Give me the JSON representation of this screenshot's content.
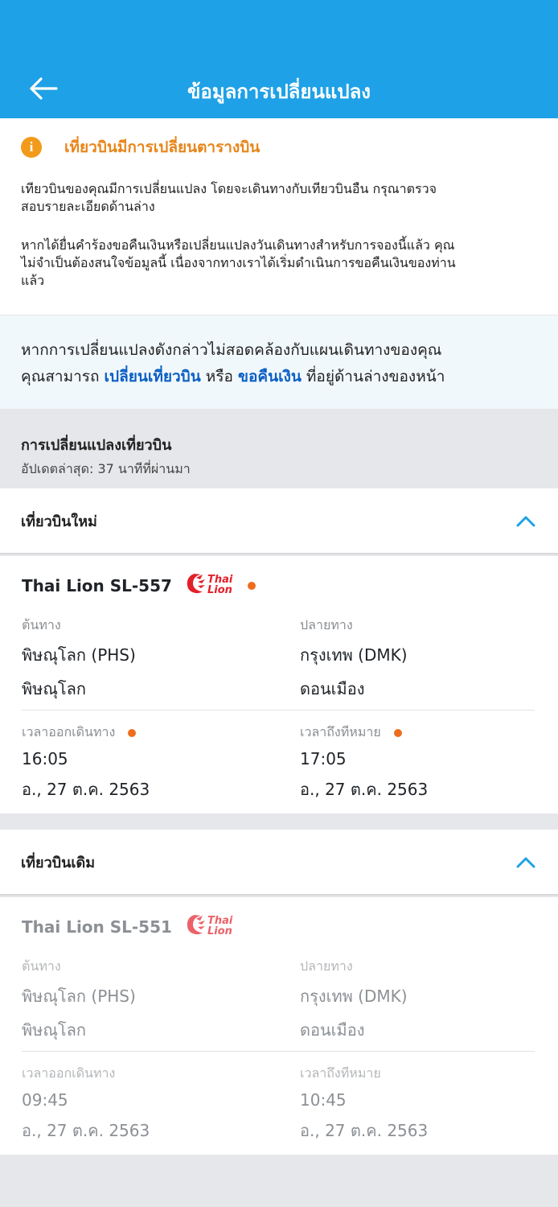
{
  "header": {
    "title": "ข้อมูลการเปลี่ยนแปลง",
    "back_icon": "arrow-left-icon"
  },
  "notice": {
    "title": "เที่ยวบินมีการเปลี่ยนตารางบิน",
    "icon": "info-icon",
    "icon_glyph": "i",
    "paragraph1_line1": "เทียวบินของคุณมีการเปลี่ยนแปลง โดยจะเดินทางกับเทียวบินอืน กรุณาตรวจ",
    "paragraph1_line2": "สอบรายละเอียดด้านล่าง",
    "paragraph2_line1": "หากได้ยื่นคำร้องขอคืนเงินหรือเปลี่ยนแปลงวันเดินทางสำหรับการจองนี้แล้ว คุณ",
    "paragraph2_line2": "ไม่จำเป็นต้องสนใจข้อมูลนี้ เนื่องจากทางเราได้เริ่มดำเนินการขอคืนเงินของท่าน",
    "paragraph2_line3": "แล้ว"
  },
  "advice": {
    "line1": "หากการเปลี่ยนแปลงดังกล่าวไม่สอดคล้องกับแผนเดินทางของคุณ",
    "line2_prefix": "คุณสามารถ ",
    "change_link": "เปลี่ยนเที่ยวบิน",
    "or": " หรือ ",
    "refund_link": "ขอคืนเงิน",
    "line2_suffix": " ที่อยู่ด้านล่างของหน้า"
  },
  "changes": {
    "title": "การเปลี่ยนแปลงเที่ยวบิน",
    "updated": "อัปเดตล่าสุด: 37 นาทีที่ผ่านมา"
  },
  "new_flight": {
    "section_title": "เที่ยวบินใหม่",
    "name": "Thai Lion SL-557",
    "origin_label": "ต้นทาง",
    "origin": "พิษณุโลก (PHS)",
    "origin_city": "พิษณุโลก",
    "dest_label": "ปลายทาง",
    "dest": "กรุงเทพ (DMK)",
    "dest_city": "ดอนเมือง",
    "dep_label": "เวลาออกเดินทาง",
    "dep_time": "16:05",
    "dep_date": "อ., 27 ต.ค. 2563",
    "arr_label": "เวลาถึงทีหมาย",
    "arr_time": "17:05",
    "arr_date": "อ., 27 ต.ค. 2563"
  },
  "old_flight": {
    "section_title": "เที่ยวบินเดิม",
    "name": "Thai Lion SL-551",
    "origin_label": "ต้นทาง",
    "origin": "พิษณุโลก (PHS)",
    "origin_city": "พิษณุโลก",
    "dest_label": "ปลายทาง",
    "dest": "กรุงเทพ (DMK)",
    "dest_city": "ดอนเมือง",
    "dep_label": "เวลาออกเดินทาง",
    "dep_time": "09:45",
    "dep_date": "อ., 27 ต.ค. 2563",
    "arr_label": "เวลาถึงทีหมาย",
    "arr_time": "10:45",
    "arr_date": "อ., 27 ต.ค. 2563"
  },
  "airline_logo": {
    "line1": "Thai",
    "line2": "Lion",
    "brand_color": "#e3202a"
  },
  "colors": {
    "header": "#1ea1e6",
    "accent_link": "#0a5fc4",
    "warning": "#f29a1a",
    "change_dot": "#ef6d1e",
    "chevron": "#1ea1e6"
  }
}
